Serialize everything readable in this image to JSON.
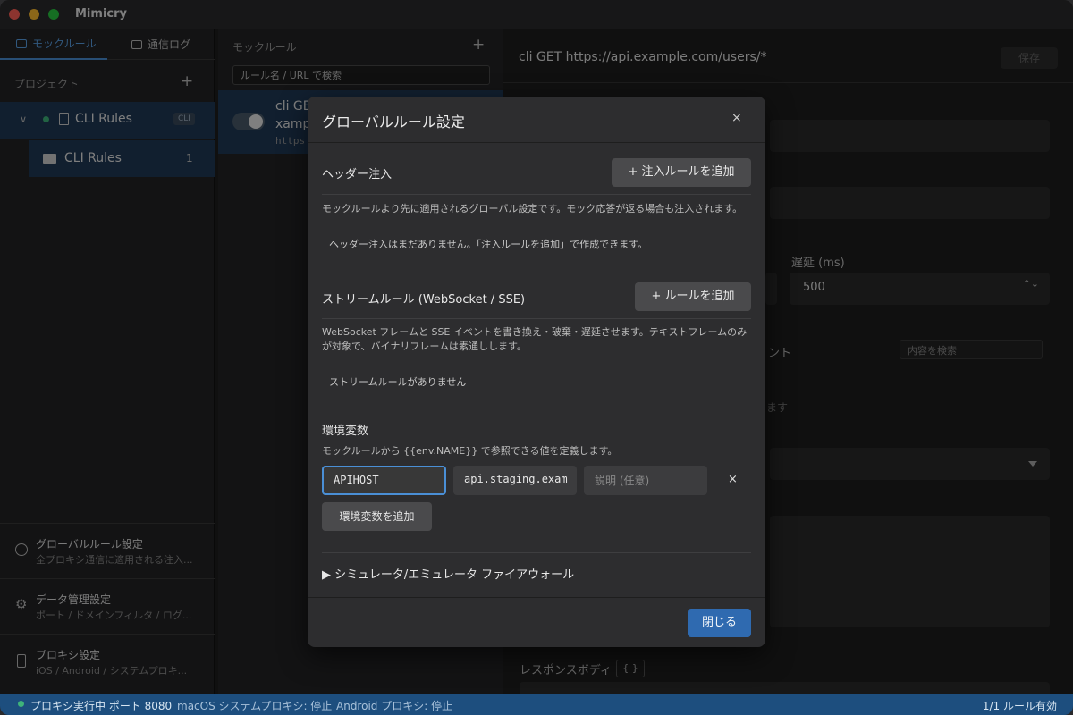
{
  "app": {
    "title": "Mimicry"
  },
  "sidebar": {
    "tabs": [
      {
        "label": "モックルール",
        "icon": "calendar-icon"
      },
      {
        "label": "通信ログ",
        "icon": "list-icon"
      }
    ],
    "project_header": "プロジェクト",
    "add_symbol": "+",
    "tree": [
      {
        "label": "CLI Rules",
        "badge": "CLI",
        "status_color": "#3fb47a"
      },
      {
        "label": "CLI Rules",
        "count": "1"
      }
    ],
    "bottom_items": [
      {
        "title": "グローバルルール設定",
        "subtitle": "全プロキシ通信に適用される注入...",
        "icon": "globe-icon"
      },
      {
        "title": "データ管理設定",
        "subtitle": "ポート / ドメインフィルタ / ログ...",
        "icon": "gear-icon"
      },
      {
        "title": "プロキシ設定",
        "subtitle": "iOS / Android / システムプロキ...",
        "icon": "phone-icon"
      }
    ]
  },
  "mock_list": {
    "header": "モックルール",
    "add_symbol": "+",
    "search_placeholder": "ルール名 / URL で検索",
    "rule": {
      "title": "cli GE",
      "subtitle": "xamp",
      "url": "https"
    }
  },
  "detail": {
    "title": "cli GET https://api.example.com/users/*",
    "save_label": "保存",
    "latency_label": "遅延 (ms)",
    "latency_value": "500",
    "stepper_symbol": "⌃⌄",
    "content_search_placeholder": "内容を検索",
    "ghost_tab_fragment": "ント",
    "ghost_text_fragment": "ます",
    "response_body_label": "レスポンスボディ",
    "brace_badge": "{ }"
  },
  "modal": {
    "title": "グローバルルール設定",
    "close_symbol": "×",
    "header_injection": {
      "title": "ヘッダー注入",
      "add_button": "+ 注入ルールを追加",
      "description": "モックルールより先に適用されるグローバル設定です。モック応答が返る場合も注入されます。",
      "empty": "ヘッダー注入はまだありません。「注入ルールを追加」で作成できます。"
    },
    "stream_rules": {
      "title": "ストリームルール (WebSocket / SSE)",
      "add_button": "+ ルールを追加",
      "description": "WebSocket フレームと SSE イベントを書き換え・破棄・遅延させます。テキストフレームのみが対象で、バイナリフレームは素通しします。",
      "empty": "ストリームルールがありません"
    },
    "env": {
      "title": "環境変数",
      "description": "モックルールから {{env.NAME}} で参照できる値を定義します。",
      "key_value": "APIHOST",
      "value_value": "api.staging.exam",
      "desc_placeholder": "説明 (任意)",
      "remove_symbol": "×",
      "add_button": "環境変数を追加"
    },
    "firewall_toggle": "▶ シミュレータ/エミュレータ ファイアウォール",
    "close_button": "閉じる"
  },
  "status_bar": {
    "proxy": "プロキシ実行中 ポート 8080",
    "macos": "macOS システムプロキシ: 停止",
    "android": "Android プロキシ: 停止",
    "rules": "1/1 ルール有効"
  },
  "colors": {
    "accent": "#4a8fd6",
    "status_bar": "#1d4e7e",
    "running": "#3fb47a",
    "primary_button": "#2f6ab0"
  }
}
